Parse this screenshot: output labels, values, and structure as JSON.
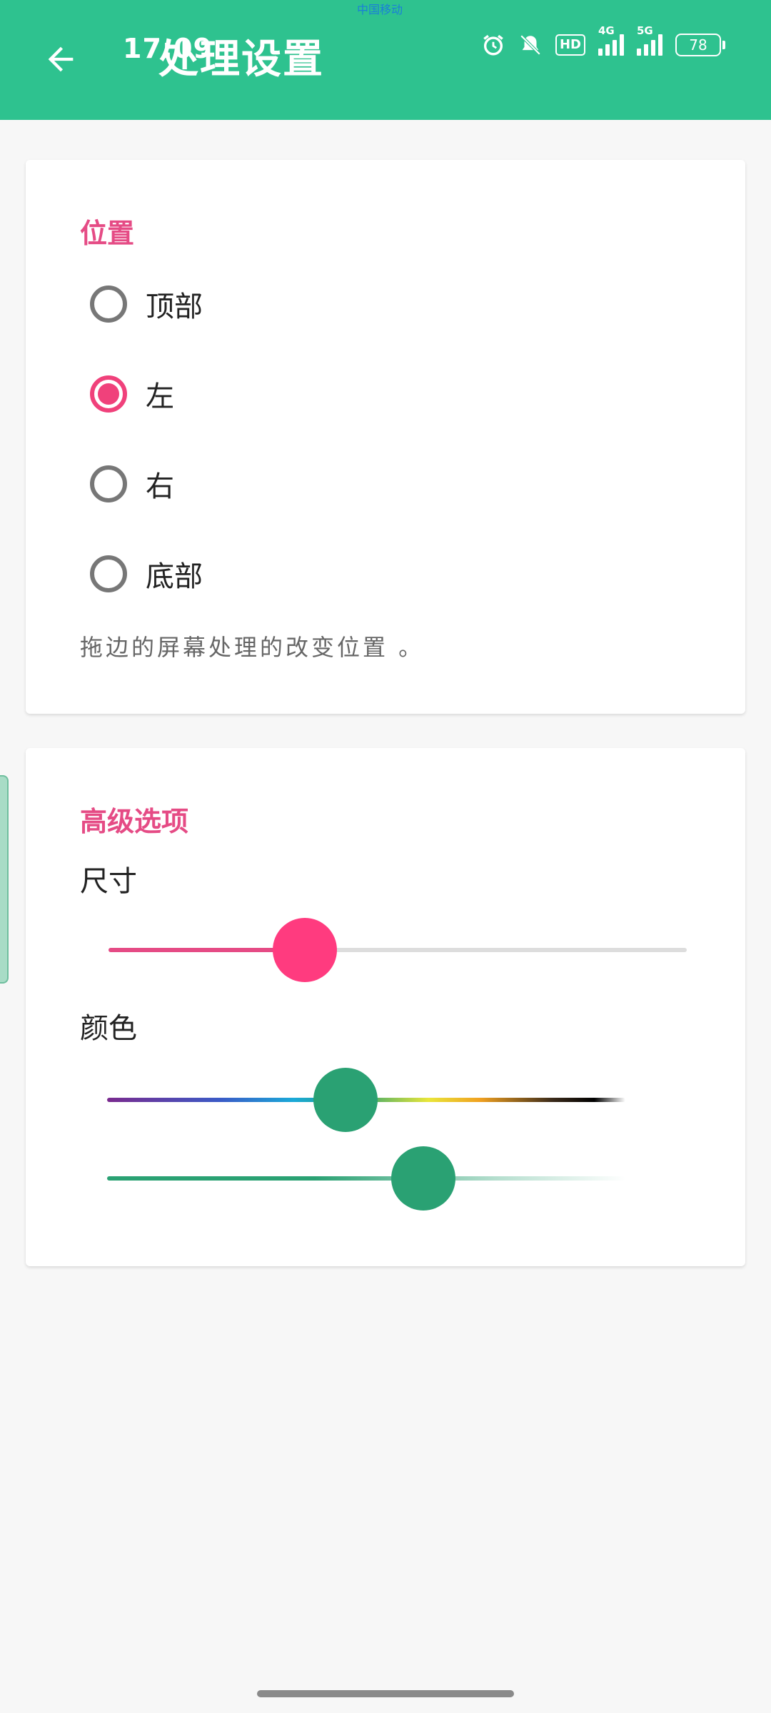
{
  "status_bar": {
    "time": "17:09",
    "carrier_text": "中国移动",
    "battery": "78",
    "hd_label": "HD",
    "net1": "4G",
    "net2": "5G"
  },
  "app_bar": {
    "title": "处理设置",
    "back_icon": "arrow-left-icon"
  },
  "position_section": {
    "title": "位置",
    "options": [
      {
        "label": "顶部",
        "checked": false
      },
      {
        "label": "左",
        "checked": true
      },
      {
        "label": "右",
        "checked": false
      },
      {
        "label": "底部",
        "checked": false
      }
    ],
    "helper_text": "拖边的屏幕处理的改变位置 。"
  },
  "advanced_section": {
    "title": "高级选项",
    "size_label": "尺寸",
    "size_value": 0.34,
    "color_label": "颜色",
    "hue_value": 0.46,
    "alpha_value": 0.61
  },
  "colors": {
    "primary": "#2ec28f",
    "accent": "#f0417b",
    "thumb_green": "#2aa173"
  }
}
